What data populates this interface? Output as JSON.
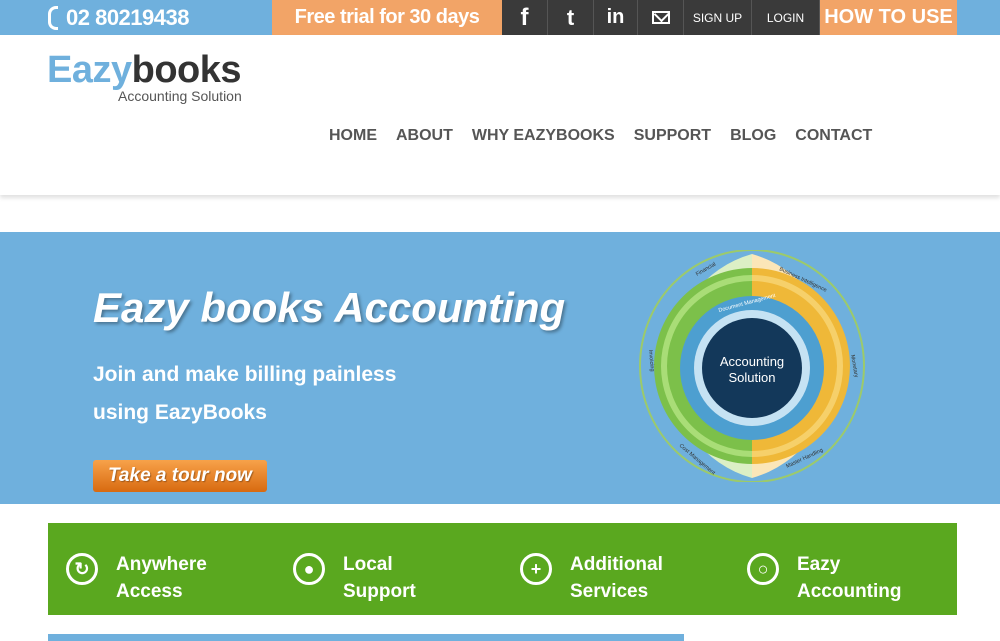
{
  "topbar": {
    "phone": "02 80219438",
    "trial": "Free trial for 30 days",
    "facebook": "f",
    "twitter": "t",
    "linkedin": "in",
    "signup": "SIGN UP",
    "login": "LOGIN",
    "howto": "HOW TO USE"
  },
  "logo": {
    "part1": "Eazy",
    "part2": "books",
    "subtitle": "Accounting Solution"
  },
  "nav": [
    "HOME",
    "ABOUT",
    "WHY EAZYBOOKS",
    "SUPPORT",
    "BLOG",
    "CONTACT"
  ],
  "hero": {
    "title": "Eazy books Accounting",
    "subtitle_line1": "Join and make billing painless",
    "subtitle_line2": "using EazyBooks",
    "cta": "Take a tour now"
  },
  "wheel": {
    "center_line1": "Accounting",
    "center_line2": "Solution",
    "labels": [
      "Financial",
      "Business Intelligence",
      "Monetary",
      "Master Handling",
      "Cost Management",
      "Invoicing",
      "Document Management"
    ]
  },
  "features": [
    {
      "line1": "Anywhere",
      "line2": "Access",
      "icon": "c"
    },
    {
      "line1": "Local",
      "line2": "Support",
      "icon": "user"
    },
    {
      "line1": "Additional",
      "line2": "Services",
      "icon": "+"
    },
    {
      "line1": "Eazy",
      "line2": "Accounting",
      "icon": "o"
    }
  ],
  "colors": {
    "blue": "#6fb0dd",
    "orange": "#f2a467",
    "green": "#5aa81f",
    "dark": "#3a3a3a"
  }
}
